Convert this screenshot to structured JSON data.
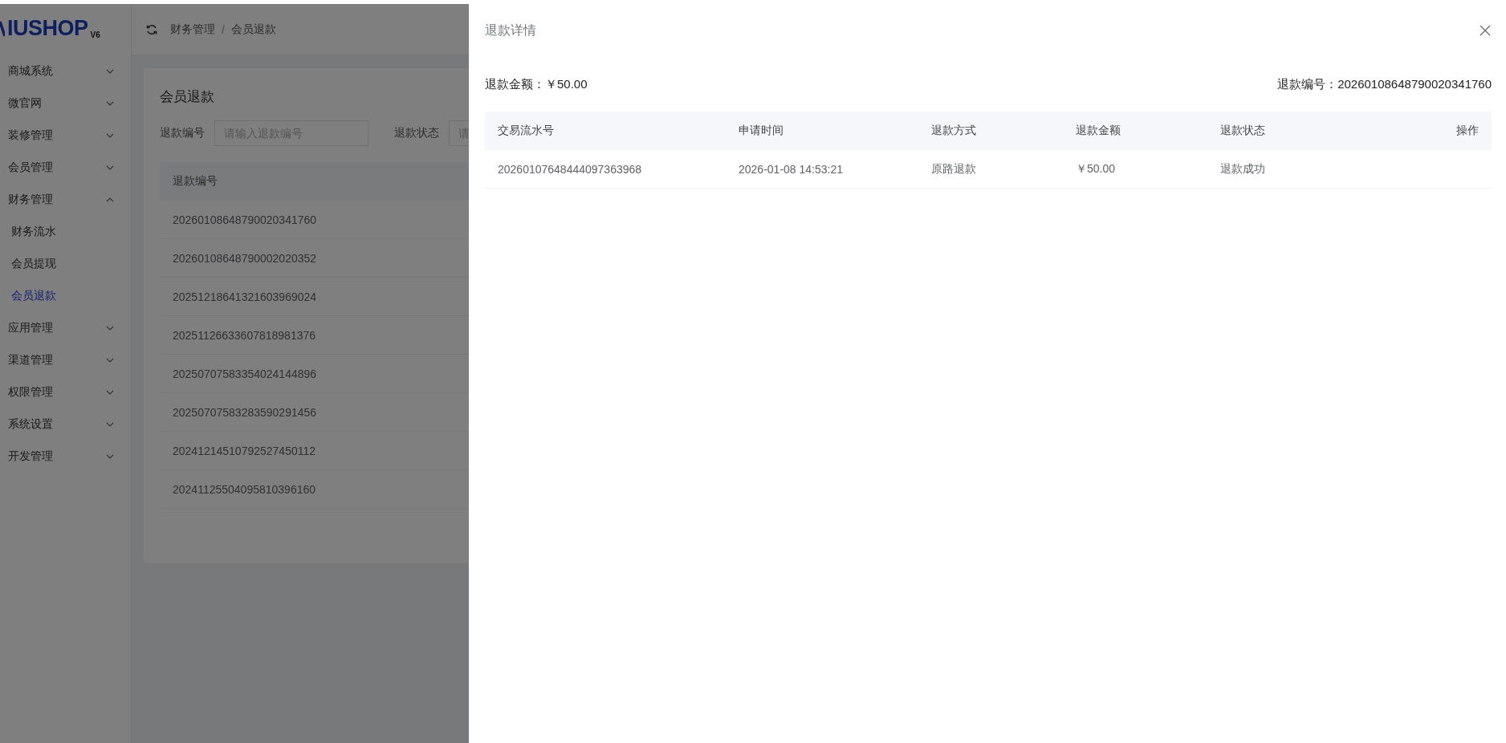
{
  "logo": {
    "text": "IUSHOP",
    "version": "V6"
  },
  "breadcrumb": [
    "财务管理",
    "会员退款"
  ],
  "breadcrumb_separator": "/",
  "sidebar": {
    "items": [
      {
        "label": "商城系统",
        "expanded": false
      },
      {
        "label": "微官网",
        "expanded": false
      },
      {
        "label": "装修管理",
        "expanded": false
      },
      {
        "label": "会员管理",
        "expanded": false
      },
      {
        "label": "财务管理",
        "expanded": true,
        "children": [
          {
            "label": "财务流水",
            "selected": false
          },
          {
            "label": "会员提现",
            "selected": false
          },
          {
            "label": "会员退款",
            "selected": true
          }
        ]
      },
      {
        "label": "应用管理",
        "expanded": false
      },
      {
        "label": "渠道管理",
        "expanded": false
      },
      {
        "label": "权限管理",
        "expanded": false
      },
      {
        "label": "系统设置",
        "expanded": false
      },
      {
        "label": "开发管理",
        "expanded": false
      }
    ]
  },
  "page": {
    "title": "会员退款",
    "filters": [
      {
        "label": "退款编号",
        "placeholder": "请输入退款编号"
      },
      {
        "label": "退款状态",
        "placeholder": "请"
      }
    ],
    "table": {
      "columns": [
        "退款编号"
      ],
      "rows": [
        [
          "20260108648790020341760"
        ],
        [
          "20260108648790002020352"
        ],
        [
          "20251218641321603969024"
        ],
        [
          "20251126633607818981376"
        ],
        [
          "20250707583354024144896"
        ],
        [
          "20250707583283590291456"
        ],
        [
          "20241214510792527450112"
        ],
        [
          "20241125504095810396160"
        ]
      ]
    }
  },
  "drawer": {
    "title": "退款详情",
    "amount": "退款金额：￥50.00",
    "refund_no": "退款编号：20260108648790020341760",
    "table": {
      "columns": [
        "交易流水号",
        "申请时间",
        "退款方式",
        "退款金额",
        "退款状态",
        "操作"
      ],
      "rows": [
        [
          "20260107648444097363968",
          "2026-01-08 14:53:21",
          "原路退款",
          "￥50.00",
          "退款成功",
          ""
        ]
      ]
    }
  }
}
